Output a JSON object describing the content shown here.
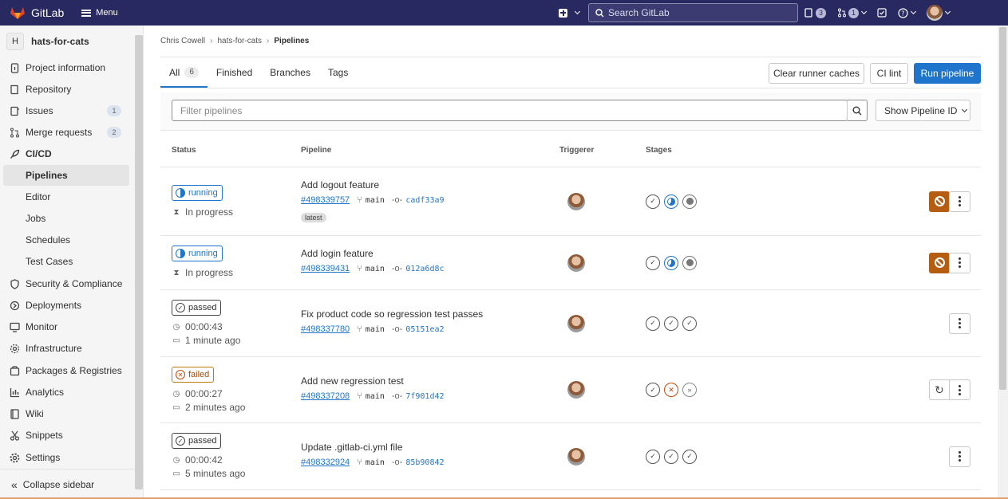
{
  "topbar": {
    "brand": "GitLab",
    "menu_label": "Menu",
    "search_placeholder": "Search GitLab",
    "issues_count": "3",
    "mr_count": "1"
  },
  "sidebar": {
    "project_initial": "H",
    "project_name": "hats-for-cats",
    "items": [
      {
        "label": "Project information",
        "icon": "info-icon"
      },
      {
        "label": "Repository",
        "icon": "book-icon"
      },
      {
        "label": "Issues",
        "icon": "issues-icon",
        "badge": "1"
      },
      {
        "label": "Merge requests",
        "icon": "merge-request-icon",
        "badge": "2"
      },
      {
        "label": "CI/CD",
        "icon": "rocket-icon"
      },
      {
        "label": "Pipelines"
      },
      {
        "label": "Editor"
      },
      {
        "label": "Jobs"
      },
      {
        "label": "Schedules"
      },
      {
        "label": "Test Cases"
      },
      {
        "label": "Security & Compliance",
        "icon": "shield-icon"
      },
      {
        "label": "Deployments",
        "icon": "deployments-icon"
      },
      {
        "label": "Monitor",
        "icon": "monitor-icon"
      },
      {
        "label": "Infrastructure",
        "icon": "cloud-gear-icon"
      },
      {
        "label": "Packages & Registries",
        "icon": "package-icon"
      },
      {
        "label": "Analytics",
        "icon": "chart-icon"
      },
      {
        "label": "Wiki",
        "icon": "wiki-icon"
      },
      {
        "label": "Snippets",
        "icon": "scissors-icon"
      },
      {
        "label": "Settings",
        "icon": "gear-icon"
      }
    ],
    "collapse_label": "Collapse sidebar"
  },
  "breadcrumb": [
    "Chris Cowell",
    "hats-for-cats",
    "Pipelines"
  ],
  "tabs": [
    {
      "label": "All",
      "count": "6"
    },
    {
      "label": "Finished"
    },
    {
      "label": "Branches"
    },
    {
      "label": "Tags"
    }
  ],
  "actions": {
    "clear_caches": "Clear runner caches",
    "ci_lint": "CI lint",
    "run_pipeline": "Run pipeline"
  },
  "filter": {
    "placeholder": "Filter pipelines",
    "id_select": "Show Pipeline ID"
  },
  "columns": {
    "status": "Status",
    "pipeline": "Pipeline",
    "triggerer": "Triggerer",
    "stages": "Stages"
  },
  "pipelines": [
    {
      "status": "running",
      "meta1": "In progress",
      "title": "Add logout feature",
      "id": "#498339757",
      "branch": "main",
      "sha": "cadf33a9",
      "tag": "latest",
      "stages": [
        "passed",
        "running",
        "created"
      ],
      "action": "cancel"
    },
    {
      "status": "running",
      "meta1": "In progress",
      "title": "Add login feature",
      "id": "#498339431",
      "branch": "main",
      "sha": "012a6d8c",
      "stages": [
        "passed",
        "running",
        "created"
      ],
      "action": "cancel"
    },
    {
      "status": "passed",
      "meta1": "00:00:43",
      "meta2": "1 minute ago",
      "title": "Fix product code so regression test passes",
      "id": "#498337780",
      "branch": "main",
      "sha": "05151ea2",
      "stages": [
        "passed",
        "passed",
        "passed"
      ]
    },
    {
      "status": "failed",
      "meta1": "00:00:27",
      "meta2": "2 minutes ago",
      "title": "Add new regression test",
      "id": "#498337208",
      "branch": "main",
      "sha": "7f901d42",
      "stages": [
        "passed",
        "failed",
        "skipped"
      ],
      "action": "retry"
    },
    {
      "status": "passed",
      "meta1": "00:00:42",
      "meta2": "5 minutes ago",
      "title": "Update .gitlab-ci.yml file",
      "id": "#498332924",
      "branch": "main",
      "sha": "85b90842",
      "stages": [
        "passed",
        "passed",
        "passed"
      ]
    }
  ],
  "colors": {
    "navbar": "#292961",
    "primary": "#1f75cb",
    "cancel": "#b55d13",
    "failed": "#c4490c"
  }
}
